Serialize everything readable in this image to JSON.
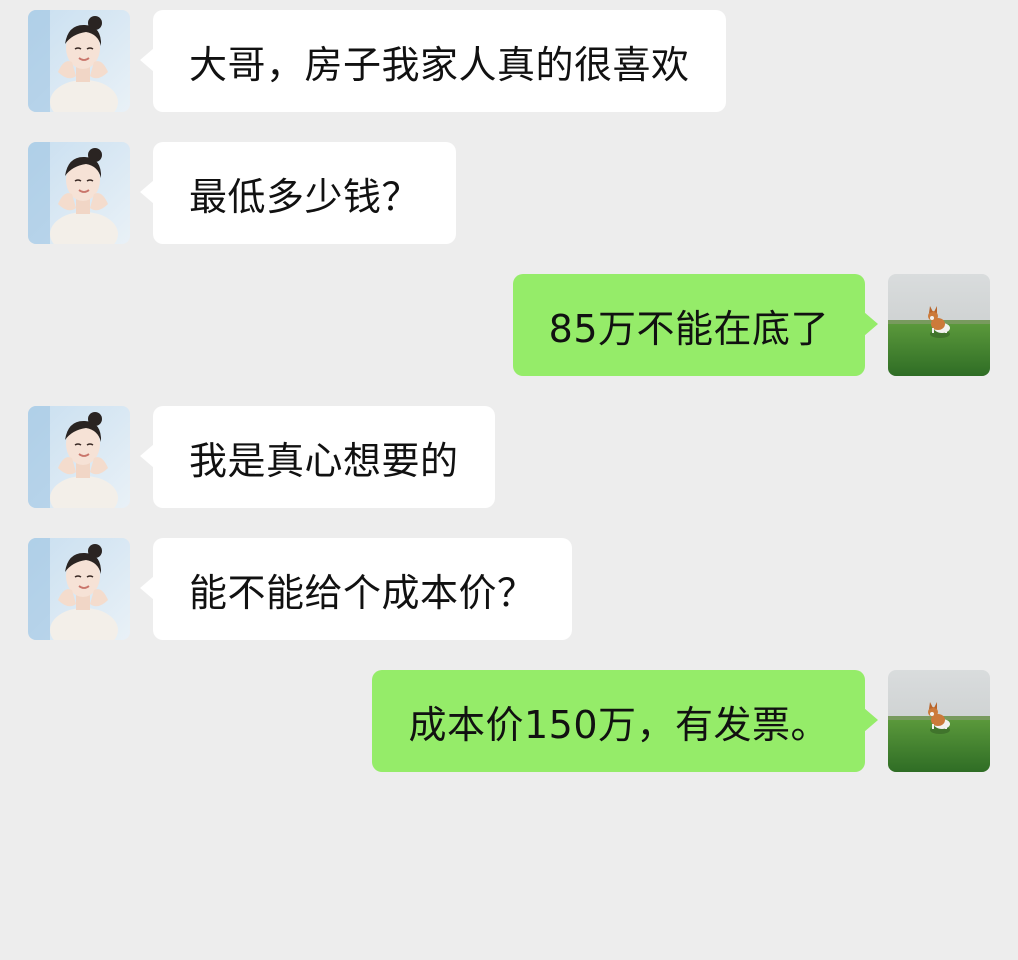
{
  "colors": {
    "background": "#ededed",
    "incoming_bubble": "#ffffff",
    "outgoing_bubble": "#95ec69",
    "text": "#111111"
  },
  "contact_avatar_icon": "woman-portrait-avatar",
  "self_avatar_icon": "corgi-on-grass-avatar",
  "messages": [
    {
      "side": "left",
      "text": "大哥，房子我家人真的很喜欢"
    },
    {
      "side": "left",
      "text": "最低多少钱？"
    },
    {
      "side": "right",
      "text": "85万不能在底了"
    },
    {
      "side": "left",
      "text": "我是真心想要的"
    },
    {
      "side": "left",
      "text": "能不能给个成本价？"
    },
    {
      "side": "right",
      "text": "成本价150万，有发票。"
    }
  ]
}
